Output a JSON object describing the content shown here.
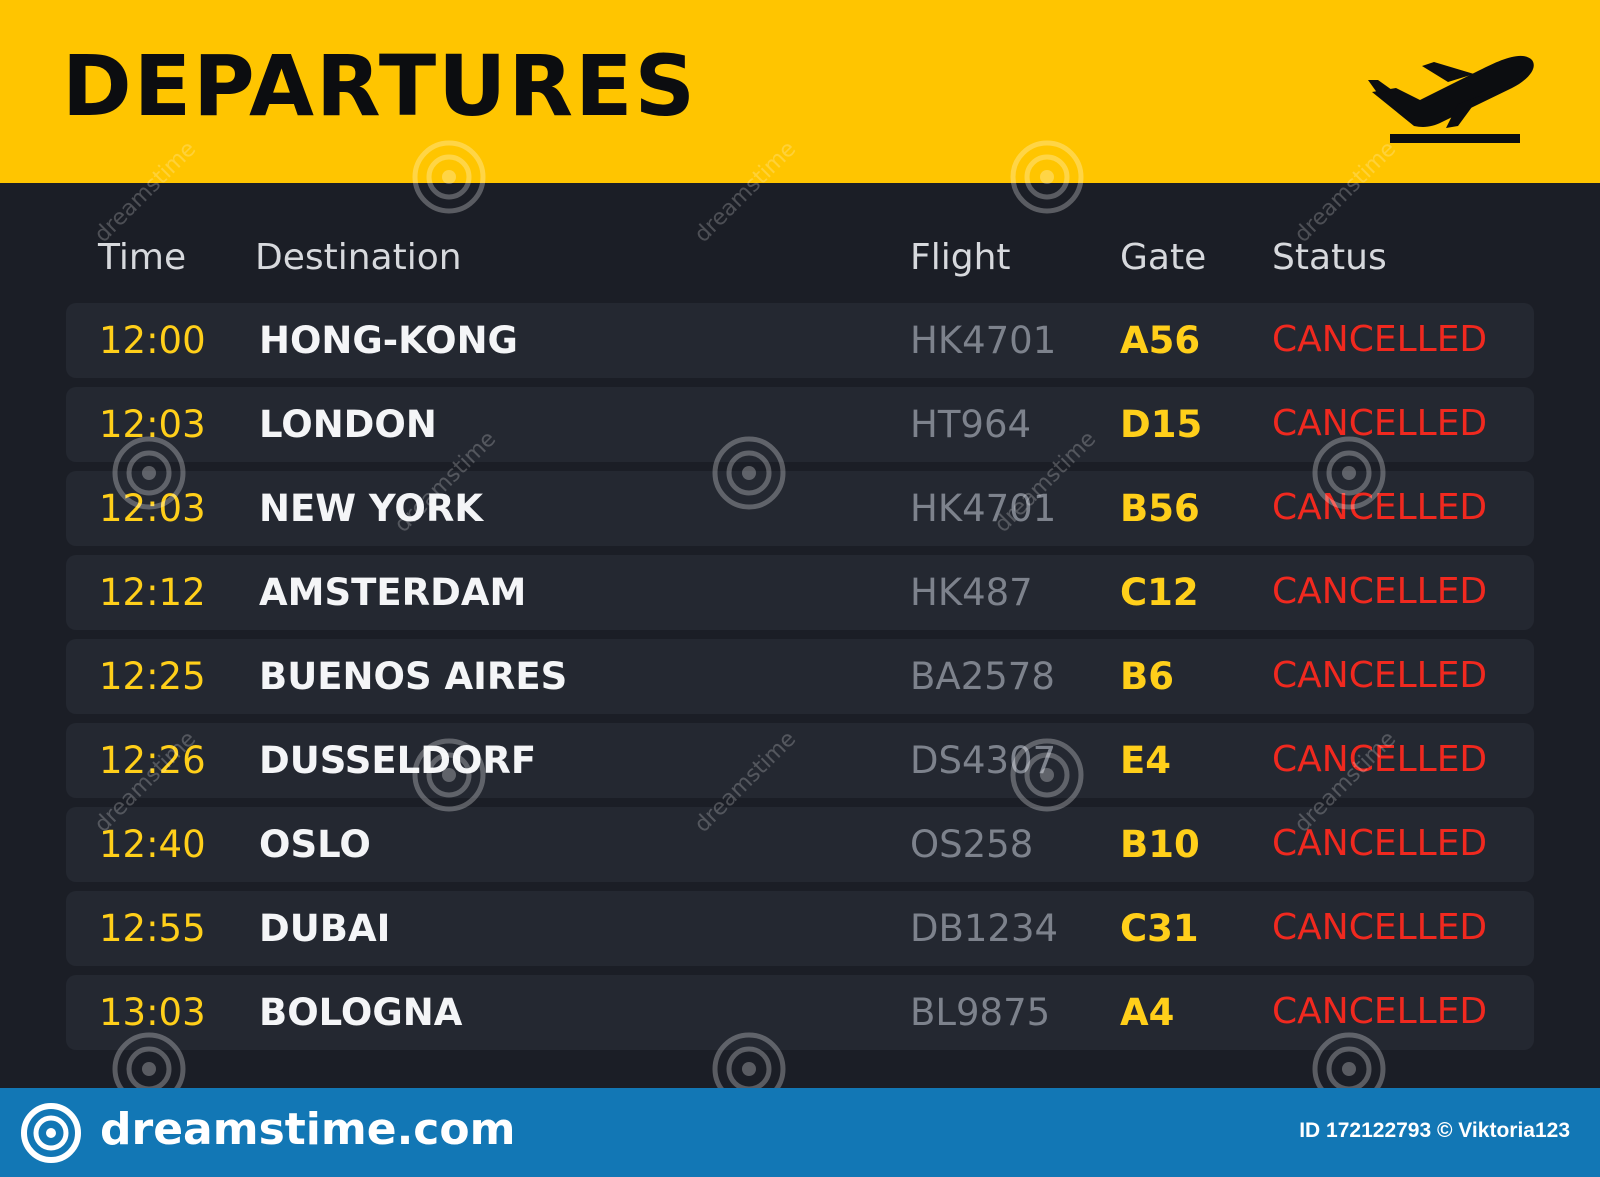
{
  "header": {
    "title": "DEPARTURES",
    "icon": "airplane-departure-icon",
    "background_color": "#ffc500"
  },
  "columns": {
    "time": "Time",
    "destination": "Destination",
    "flight": "Flight",
    "gate": "Gate",
    "status": "Status"
  },
  "flights": [
    {
      "time": "12:00",
      "destination": "HONG-KONG",
      "flight": "HK4701",
      "gate": "A56",
      "status": "CANCELLED"
    },
    {
      "time": "12:03",
      "destination": "LONDON",
      "flight": "HT964",
      "gate": "D15",
      "status": "CANCELLED"
    },
    {
      "time": "12:03",
      "destination": "NEW YORK",
      "flight": "HK4701",
      "gate": "B56",
      "status": "CANCELLED"
    },
    {
      "time": "12:12",
      "destination": "AMSTERDAM",
      "flight": "HK487",
      "gate": "C12",
      "status": "CANCELLED"
    },
    {
      "time": "12:25",
      "destination": "BUENOS AIRES",
      "flight": "BA2578",
      "gate": "B6",
      "status": "CANCELLED"
    },
    {
      "time": "12:26",
      "destination": "DUSSELDORF",
      "flight": "DS4307",
      "gate": "E4",
      "status": "CANCELLED"
    },
    {
      "time": "12:40",
      "destination": "OSLO",
      "flight": "OS258",
      "gate": "B10",
      "status": "CANCELLED"
    },
    {
      "time": "12:55",
      "destination": "DUBAI",
      "flight": "DB1234",
      "gate": "C31",
      "status": "CANCELLED"
    },
    {
      "time": "13:03",
      "destination": "BOLOGNA",
      "flight": "BL9875",
      "gate": "A4",
      "status": "CANCELLED"
    }
  ],
  "colors": {
    "time": "#ffcf1a",
    "gate": "#ffcf1a",
    "status_cancelled": "#f0291f",
    "flight": "#7d828c",
    "board_background": "#1b1e26",
    "row_background": "#242831"
  },
  "watermark": {
    "text": "dreamstime"
  },
  "footer": {
    "logo_text": "dreamstime.com",
    "image_id": "ID 172122793 © Viktoria123",
    "background_color": "#1277b5"
  }
}
